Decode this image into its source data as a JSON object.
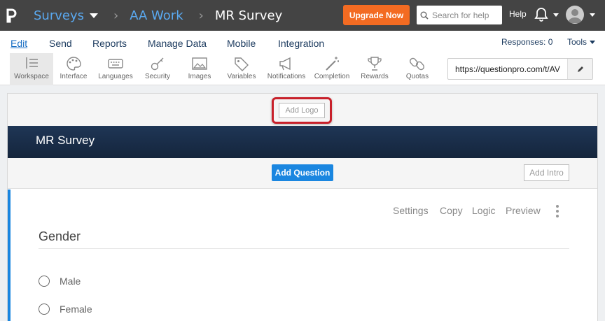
{
  "topbar": {
    "surveys_label": "Surveys",
    "folder_label": "AA Work",
    "survey_title": "MR Survey",
    "upgrade_label": "Upgrade Now",
    "search_placeholder": "Search for help",
    "help_label": "Help"
  },
  "menu": {
    "items": [
      "Edit",
      "Send",
      "Reports",
      "Manage Data",
      "Mobile",
      "Integration"
    ],
    "responses": "Responses: 0",
    "tools": "Tools"
  },
  "toolbar": {
    "tools": [
      "Workspace",
      "Interface",
      "Languages",
      "Security",
      "Images",
      "Variables",
      "Notifications",
      "Completion",
      "Rewards",
      "Quotas"
    ],
    "url": "https://questionpro.com/t/AV"
  },
  "canvas": {
    "add_logo": "Add Logo",
    "banner_title": "MR Survey",
    "add_question": "Add Question",
    "add_intro": "Add Intro",
    "question": {
      "actions": [
        "Settings",
        "Copy",
        "Logic",
        "Preview"
      ],
      "title": "Gender",
      "options": [
        "Male",
        "Female"
      ]
    }
  },
  "colors": {
    "accent": "#1a86e0",
    "upgrade": "#f36b22",
    "banner": "#1f3656",
    "highlight": "#c8202a"
  }
}
